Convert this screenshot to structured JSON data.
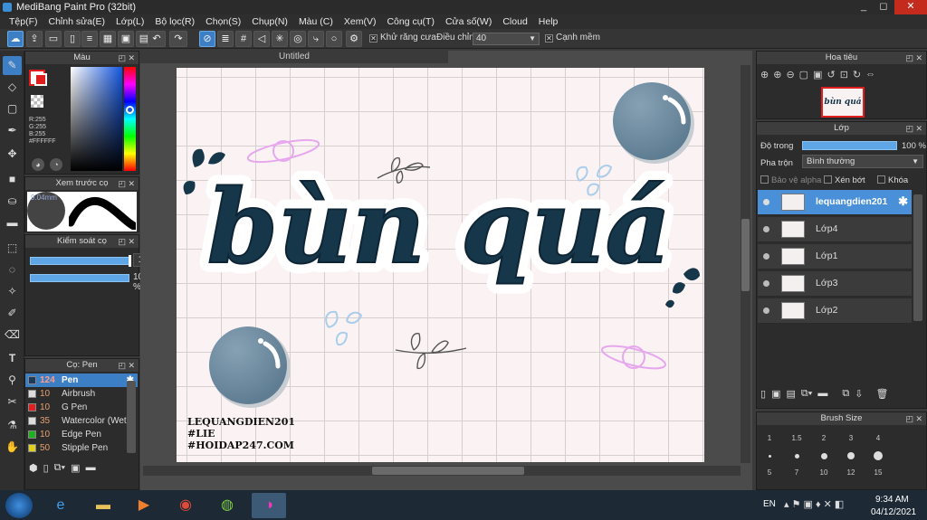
{
  "window": {
    "title": "MediBang Paint Pro (32bit)",
    "min": "_",
    "max": "◻",
    "close": "✕"
  },
  "menu": [
    "Tệp(F)",
    "Chỉnh sửa(E)",
    "Lớp(L)",
    "Bộ lọc(R)",
    "Chọn(S)",
    "Chụp(N)",
    "Màu (C)",
    "Xem(V)",
    "Công cụ(T)",
    "Cửa số(W)",
    "Cloud",
    "Help"
  ],
  "toolbar": {
    "antialias_label": "Khử răng cưa",
    "adjust_label": "Điều chỉnh",
    "adjust_value": "40",
    "sharp_label": "Cạnh mềm"
  },
  "color_panel": {
    "title": "Màu",
    "r": "R:255",
    "g": "G:255",
    "b": "B:255",
    "hex": "#FFFFFF"
  },
  "preview_panel": {
    "title": "Xem trước cọ",
    "size": "9.04mm"
  },
  "control_panel": {
    "title": "Kiểm soát cọ",
    "size_value": "124",
    "opacity_value": "100 %"
  },
  "brush_panel": {
    "title": "Cọ: Pen",
    "items": [
      {
        "size": "124",
        "name": "Pen",
        "color": "#1f3a5a"
      },
      {
        "size": "10",
        "name": "Airbrush",
        "color": "#dddddd"
      },
      {
        "size": "10",
        "name": "G Pen",
        "color": "#e02020"
      },
      {
        "size": "35",
        "name": "Watercolor (Wet)",
        "color": "#dddddd"
      },
      {
        "size": "10",
        "name": "Edge Pen",
        "color": "#20b020"
      },
      {
        "size": "50",
        "name": "Stipple Pen",
        "color": "#e0d020"
      }
    ]
  },
  "document": {
    "tab": "Untitled"
  },
  "artwork": {
    "main_text": "bùn quá",
    "credit1": "LEQUANGDIEN201",
    "credit2": "#LIE",
    "credit3": "#HOIDAP247.COM"
  },
  "navigator": {
    "title": "Hoa tiêu",
    "thumb_text": "bùn quá"
  },
  "layer_panel": {
    "title": "Lớp",
    "opacity_label": "Độ trong",
    "opacity_value": "100 %",
    "blend_label": "Pha trộn",
    "blend_value": "Bình thường",
    "alpha_label": "Bảo vệ alpha",
    "clip_label": "Xén bớt",
    "lock_label": "Khóa",
    "layers": [
      {
        "name": "lequangdien201",
        "selected": true
      },
      {
        "name": "Lớp4",
        "selected": false
      },
      {
        "name": "Lớp1",
        "selected": false
      },
      {
        "name": "Lớp3",
        "selected": false
      },
      {
        "name": "Lớp2",
        "selected": false
      }
    ]
  },
  "brush_size_panel": {
    "title": "Brush Size",
    "sizes": [
      "1",
      "1.5",
      "2",
      "3",
      "4",
      "5",
      "7",
      "10",
      "12",
      "15"
    ]
  },
  "taskbar": {
    "lang": "EN",
    "time": "9:34 AM",
    "date": "04/12/2021"
  },
  "colors": {
    "accent": "#3c7fc5",
    "ink": "#16364a",
    "lavender": "#e7a7ee",
    "skyblue": "#a9cdeb"
  }
}
